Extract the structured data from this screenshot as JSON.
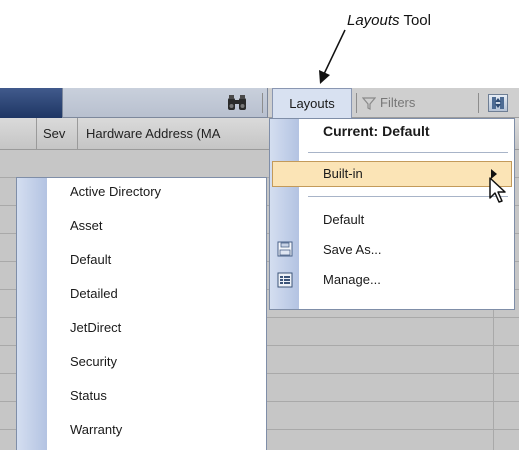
{
  "callout": {
    "italic": "Layouts",
    "rest": " Tool"
  },
  "toolbar": {
    "search_value": "",
    "layouts_tab": "Layouts",
    "filters_label": "Filters"
  },
  "grid": {
    "headers": [
      "Sev",
      "Hardware Address (MA"
    ]
  },
  "layouts_menu": {
    "current": "Current: Default",
    "items": [
      "Built-in",
      "Default",
      "Save As...",
      "Manage..."
    ]
  },
  "builtin_submenu": {
    "items": [
      "Active Directory",
      "Asset",
      "Default",
      "Detailed",
      "JetDirect",
      "Security",
      "Status",
      "Warranty"
    ]
  },
  "icons": {
    "find": "binoculars-icon",
    "filter": "funnel-icon",
    "column_chooser": "column-chooser-icon",
    "save_as": "floppy-disk-icon",
    "manage": "list-manage-icon",
    "submenu": "chevron-right-icon",
    "cursor": "mouse-pointer-icon"
  },
  "colors": {
    "toolbar_blue": "#2b4577",
    "highlight": "#fbe4b6",
    "menu_gutter": "#c5d3ea"
  }
}
